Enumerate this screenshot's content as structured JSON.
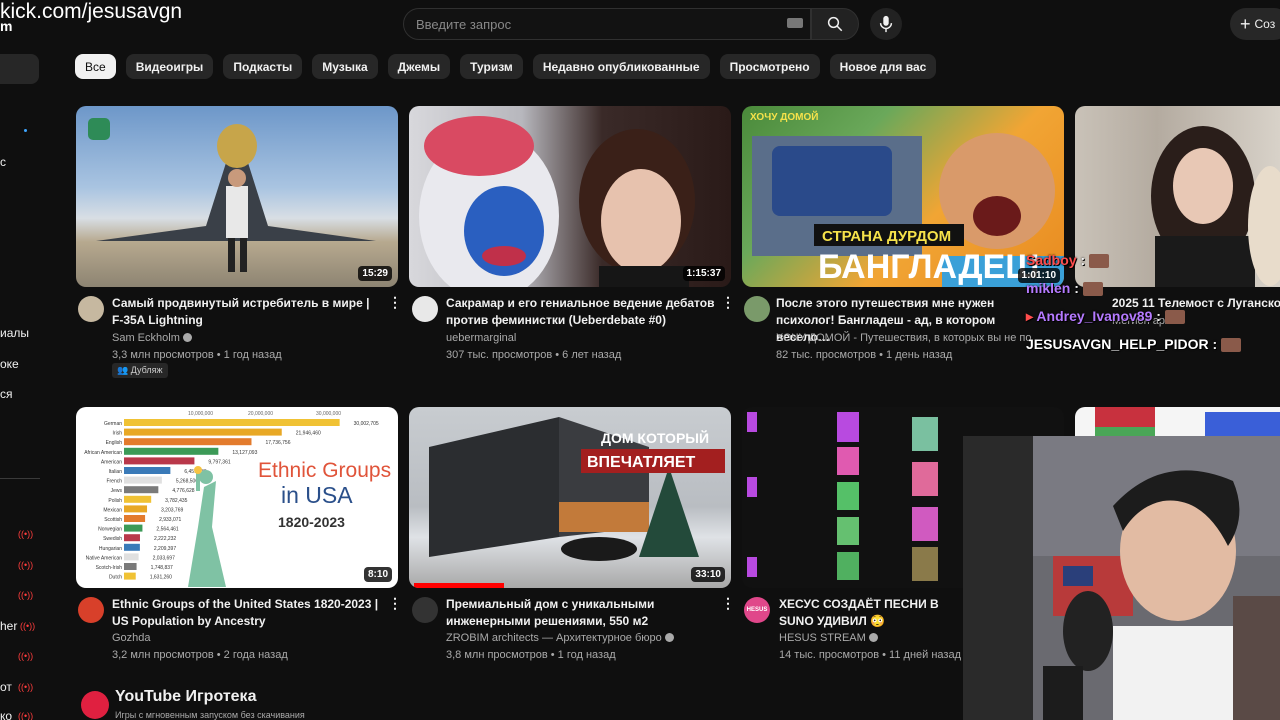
{
  "overlay": {
    "url": "kick.com/jesusavgn",
    "sub": "m"
  },
  "header": {
    "search_placeholder": "Введите запрос",
    "create_label": "Соз"
  },
  "sidebar": {
    "fragments": [
      "с",
      "иалы",
      "оке",
      "ся",
      "her",
      "от",
      "ко"
    ]
  },
  "chips": [
    "Все",
    "Видеоигры",
    "Подкасты",
    "Музыка",
    "Джемы",
    "Туризм",
    "Недавно опубликованные",
    "Просмотрено",
    "Новое для вас"
  ],
  "videos": [
    {
      "title": "Самый продвинутый истребитель в мире | F-35A Lightning",
      "channel": "Sam Eckholm",
      "meta": "3,3 млн просмотров • 1 год назад",
      "duration": "15:29",
      "badge": "Дубляж"
    },
    {
      "title": "Сакрамар и его гениальное ведение дебатов против феминистки (Ueberdebate #0)",
      "channel": "uebermarginal",
      "meta": "307 тыс. просмотров • 6 лет назад",
      "duration": "1:15:37"
    },
    {
      "title": "После этого путешествия мне нужен психолог! Бангладеш - ад, в котором весело…",
      "channel": "ХОЧУ ДОМОЙ - Путешествия, в которых вы не по",
      "meta": "82 тыс. просмотров • 1 день назад",
      "duration": "1:01:10",
      "thumb_top": "ХОЧУ ДОМОЙ",
      "thumb_line1": "СТРАНА ДУРДОМ",
      "thumb_line2": "БАНГЛАДЕШ"
    },
    {
      "title": "2025 11 Телемост с Луганско",
      "channel": "Мегион архив",
      "meta": ""
    },
    {
      "title": "Ethnic Groups of the United States 1820-2023 | US Population by Ancestry",
      "channel": "Gozhda",
      "meta": "3,2 млн просмотров • 2 года назад",
      "duration": "8:10",
      "thumb_line1": "Ethnic Groups",
      "thumb_line2": "in USA",
      "thumb_line3": "1820-2023"
    },
    {
      "title": "Премиальный дом с уникальными инженерными решениями, 550 м2",
      "channel": "ZROBIM architects — Архитектурное бюро",
      "meta": "3,8 млн просмотров • 1 год назад",
      "duration": "33:10",
      "thumb_line1": "ДОМ КОТОРЫЙ",
      "thumb_line2": "ВПЕЧАТЛЯЕТ"
    },
    {
      "title": "ХЕСУС СОЗДАЁТ ПЕСНИ В SUNO УДИВИЛ 😳",
      "channel": "HESUS STREAM",
      "meta": "14 тыс. просмотров • 11 дней назад",
      "avatar_text": "HESUS"
    }
  ],
  "chart_bars": [
    {
      "label": "German",
      "value": ""
    },
    {
      "label": "Irish",
      "value": "21,946,460"
    },
    {
      "label": "English",
      "value": "17,736,756"
    },
    {
      "label": "African American",
      "value": "13,127,093"
    },
    {
      "label": "American",
      "value": "9,797,361"
    },
    {
      "label": "Italian",
      "value": "6,451,336"
    },
    {
      "label": "French",
      "value": "5,268,500"
    },
    {
      "label": "Jews",
      "value": "4,776,628"
    },
    {
      "label": "Polish",
      "value": "3,782,435"
    },
    {
      "label": "Mexican",
      "value": "3,203,769"
    },
    {
      "label": "Scottish",
      "value": "2,933,071"
    },
    {
      "label": "Norwegian",
      "value": "2,564,461"
    },
    {
      "label": "Swedish",
      "value": "2,222,232"
    },
    {
      "label": "Hungarian",
      "value": "2,209,397"
    },
    {
      "label": "Native American",
      "value": "2,033,697"
    },
    {
      "label": "Scotch-Irish",
      "value": "1,748,837"
    },
    {
      "label": "Dutch",
      "value": "1,631,260"
    }
  ],
  "chart_axis": [
    "10,000,000",
    "20,000,000",
    "30,000,000"
  ],
  "chart_first_value": "30,002,705",
  "section": {
    "title": "YouTube Игротека",
    "subtitle": "Игры с мгновенным запуском без скачивания"
  },
  "chat": [
    {
      "user": "Sadboy",
      "color": "#ff4d4d"
    },
    {
      "user": "miklen",
      "color": "#b57aff"
    },
    {
      "user": "Andrey_Ivanov89",
      "color": "#b57aff"
    },
    {
      "user": "JESUSAVGN_HELP_PIDOR",
      "color": "#ffffff"
    }
  ],
  "chat_sep": ":"
}
